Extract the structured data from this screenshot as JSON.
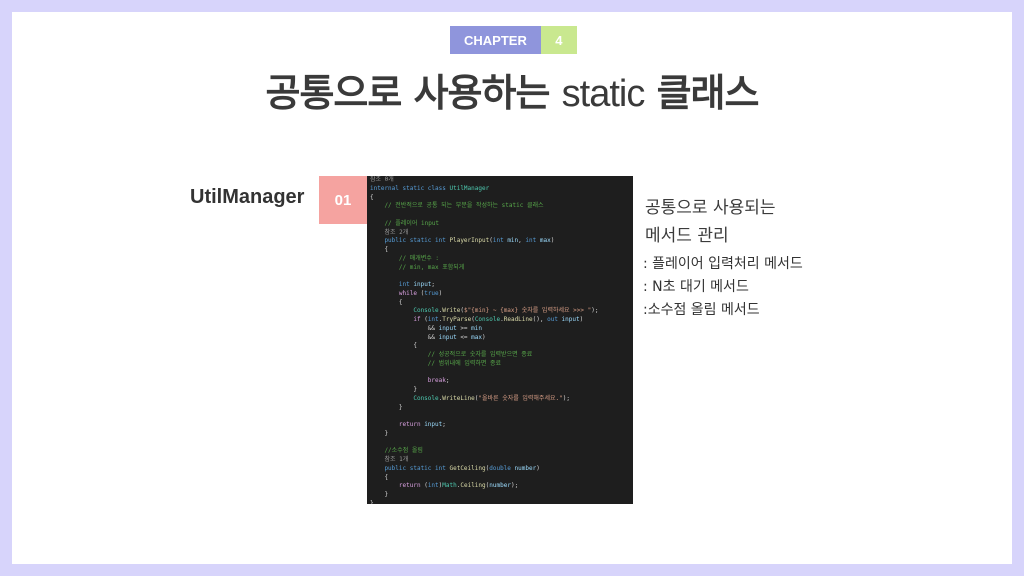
{
  "chapter": {
    "label": "CHAPTER",
    "number": "4"
  },
  "title": {
    "korean": "공통으로 사용하는",
    "latin": "static",
    "suffix": "클래스"
  },
  "section": {
    "name": "UtilManager",
    "number": "01"
  },
  "description": {
    "title_line1": "공통으로 사용되는",
    "title_line2": "메서드 관리",
    "items": [
      ": 플레이어 입력처리 메서드",
      ": N초 대기 메서드",
      ":소수점 올림 메서드"
    ]
  },
  "code_lines": [
    [
      [
        "ref",
        "참조 0개"
      ]
    ],
    [
      [
        "kw",
        "internal static class "
      ],
      [
        "type",
        "UtilManager"
      ]
    ],
    [
      [
        "txt",
        "{"
      ]
    ],
    [
      [
        "com",
        "    // 전반적으로 공통 되는 부분을 작성하는 static 클래스"
      ]
    ],
    [
      [
        "txt",
        ""
      ]
    ],
    [
      [
        "com",
        "    // 플레이어 input"
      ]
    ],
    [
      [
        "ref",
        "    참조 2개"
      ]
    ],
    [
      [
        "kw",
        "    public static int "
      ],
      [
        "fn",
        "PlayerInput"
      ],
      [
        "txt",
        "("
      ],
      [
        "kw",
        "int "
      ],
      [
        "var",
        "min"
      ],
      [
        "txt",
        ", "
      ],
      [
        "kw",
        "int "
      ],
      [
        "var",
        "max"
      ],
      [
        "txt",
        ")"
      ]
    ],
    [
      [
        "txt",
        "    {"
      ]
    ],
    [
      [
        "com",
        "        // 매개변수 :"
      ]
    ],
    [
      [
        "com",
        "        // min, max 포함되게"
      ]
    ],
    [
      [
        "txt",
        ""
      ]
    ],
    [
      [
        "kw",
        "        int "
      ],
      [
        "var",
        "input"
      ],
      [
        "txt",
        ";"
      ]
    ],
    [
      [
        "ctl",
        "        while "
      ],
      [
        "txt",
        "("
      ],
      [
        "kw",
        "true"
      ],
      [
        "txt",
        ")"
      ]
    ],
    [
      [
        "txt",
        "        {"
      ]
    ],
    [
      [
        "type",
        "            Console"
      ],
      [
        "txt",
        "."
      ],
      [
        "fn",
        "Write"
      ],
      [
        "txt",
        "("
      ],
      [
        "str",
        "$\"{min} ~ {max} 숫자를 입력하세요 >>> \""
      ],
      [
        "txt",
        ");"
      ]
    ],
    [
      [
        "ctl",
        "            if "
      ],
      [
        "txt",
        "("
      ],
      [
        "kw",
        "int"
      ],
      [
        "txt",
        "."
      ],
      [
        "fn",
        "TryParse"
      ],
      [
        "txt",
        "("
      ],
      [
        "type",
        "Console"
      ],
      [
        "txt",
        "."
      ],
      [
        "fn",
        "ReadLine"
      ],
      [
        "txt",
        "(), "
      ],
      [
        "kw",
        "out "
      ],
      [
        "var",
        "input"
      ],
      [
        "txt",
        ")"
      ]
    ],
    [
      [
        "txt",
        "                && "
      ],
      [
        "var",
        "input"
      ],
      [
        "txt",
        " >= "
      ],
      [
        "var",
        "min"
      ]
    ],
    [
      [
        "txt",
        "                && "
      ],
      [
        "var",
        "input"
      ],
      [
        "txt",
        " <= "
      ],
      [
        "var",
        "max"
      ],
      [
        "txt",
        ")"
      ]
    ],
    [
      [
        "txt",
        "            {"
      ]
    ],
    [
      [
        "com",
        "                // 성공적으로 숫자를 입력받으면 종료"
      ]
    ],
    [
      [
        "com",
        "                // 범위내에 입력하면 종료"
      ]
    ],
    [
      [
        "txt",
        ""
      ]
    ],
    [
      [
        "ctl",
        "                break"
      ],
      [
        "txt",
        ";"
      ]
    ],
    [
      [
        "txt",
        "            }"
      ]
    ],
    [
      [
        "type",
        "            Console"
      ],
      [
        "txt",
        "."
      ],
      [
        "fn",
        "WriteLine"
      ],
      [
        "txt",
        "("
      ],
      [
        "str",
        "\"올바른 숫자를 입력해주세요.\""
      ],
      [
        "txt",
        ");"
      ]
    ],
    [
      [
        "txt",
        "        }"
      ]
    ],
    [
      [
        "txt",
        ""
      ]
    ],
    [
      [
        "ctl",
        "        return "
      ],
      [
        "var",
        "input"
      ],
      [
        "txt",
        ";"
      ]
    ],
    [
      [
        "txt",
        "    }"
      ]
    ],
    [
      [
        "txt",
        ""
      ]
    ],
    [
      [
        "com",
        "    //소수점 올림"
      ]
    ],
    [
      [
        "ref",
        "    참조 1개"
      ]
    ],
    [
      [
        "kw",
        "    public static int "
      ],
      [
        "fn",
        "GetCeiling"
      ],
      [
        "txt",
        "("
      ],
      [
        "kw",
        "double "
      ],
      [
        "var",
        "number"
      ],
      [
        "txt",
        ")"
      ]
    ],
    [
      [
        "txt",
        "    {"
      ]
    ],
    [
      [
        "ctl",
        "        return "
      ],
      [
        "txt",
        "("
      ],
      [
        "kw",
        "int"
      ],
      [
        "txt",
        ")"
      ],
      [
        "type",
        "Math"
      ],
      [
        "txt",
        "."
      ],
      [
        "fn",
        "Ceiling"
      ],
      [
        "txt",
        "("
      ],
      [
        "var",
        "number"
      ],
      [
        "txt",
        ");"
      ]
    ],
    [
      [
        "txt",
        "    }"
      ]
    ],
    [
      [
        "txt",
        "}"
      ]
    ]
  ]
}
